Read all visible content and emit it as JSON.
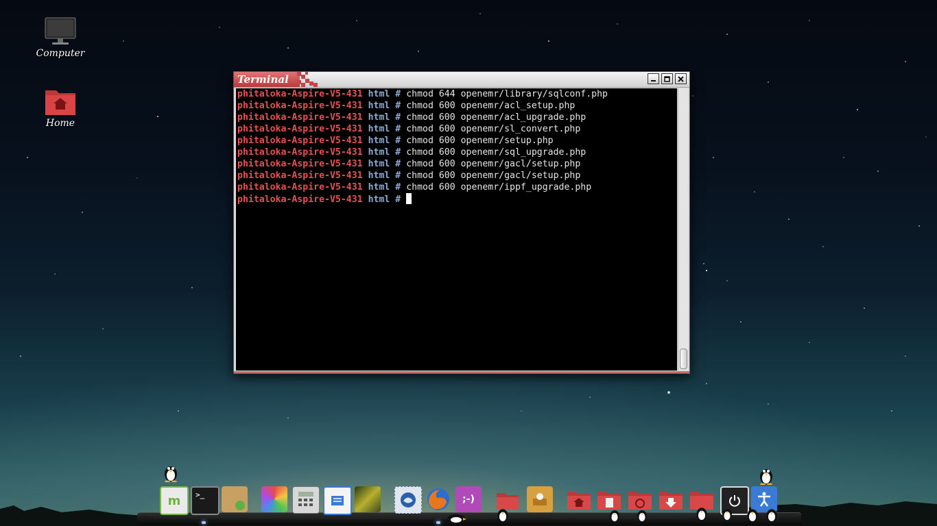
{
  "desktop": {
    "icons": [
      {
        "label": "Computer",
        "icon": "monitor-icon"
      },
      {
        "label": "Home",
        "icon": "home-folder-icon"
      }
    ]
  },
  "terminal": {
    "title": "Terminal",
    "prompt": {
      "host": "phitaloka-Aspire-V5-431",
      "dir": "html",
      "symbol": "#"
    },
    "lines": [
      "chmod 644 openemr/library/sqlconf.php",
      "chmod 600 openemr/acl_setup.php",
      "chmod 600 openemr/acl_upgrade.php",
      "chmod 600 openemr/sl_convert.php",
      "chmod 600 openemr/setup.php",
      "chmod 600 openemr/sql_upgrade.php",
      "chmod 600 openemr/gacl/setup.php",
      "chmod 600 openemr/gacl/setup.php",
      "chmod 600 openemr/ippf_upgrade.php"
    ],
    "colors": {
      "host": "#e55252",
      "dir": "#8aa9d6",
      "text": "#e6e6e6",
      "background": "#000000"
    }
  },
  "dock": {
    "items": [
      {
        "name": "mint-menu-icon"
      },
      {
        "name": "terminal-icon"
      },
      {
        "name": "package-installer-icon"
      },
      {
        "name": "paint-icon"
      },
      {
        "name": "calculator-icon"
      },
      {
        "name": "text-editor-icon"
      },
      {
        "name": "image-viewer-icon"
      },
      {
        "name": "thunderbird-mail-icon"
      },
      {
        "name": "firefox-icon"
      },
      {
        "name": "chat-icon"
      },
      {
        "name": "folders-icon"
      },
      {
        "name": "archive-manager-icon"
      },
      {
        "name": "home-folder-icon"
      },
      {
        "name": "documents-folder-icon"
      },
      {
        "name": "music-folder-icon"
      },
      {
        "name": "downloads-folder-icon"
      },
      {
        "name": "trash-folder-icon"
      },
      {
        "name": "power-icon"
      },
      {
        "name": "accessibility-icon"
      }
    ],
    "terminal_prompt_glyph": ">_",
    "chat_glyph": ";-)"
  }
}
